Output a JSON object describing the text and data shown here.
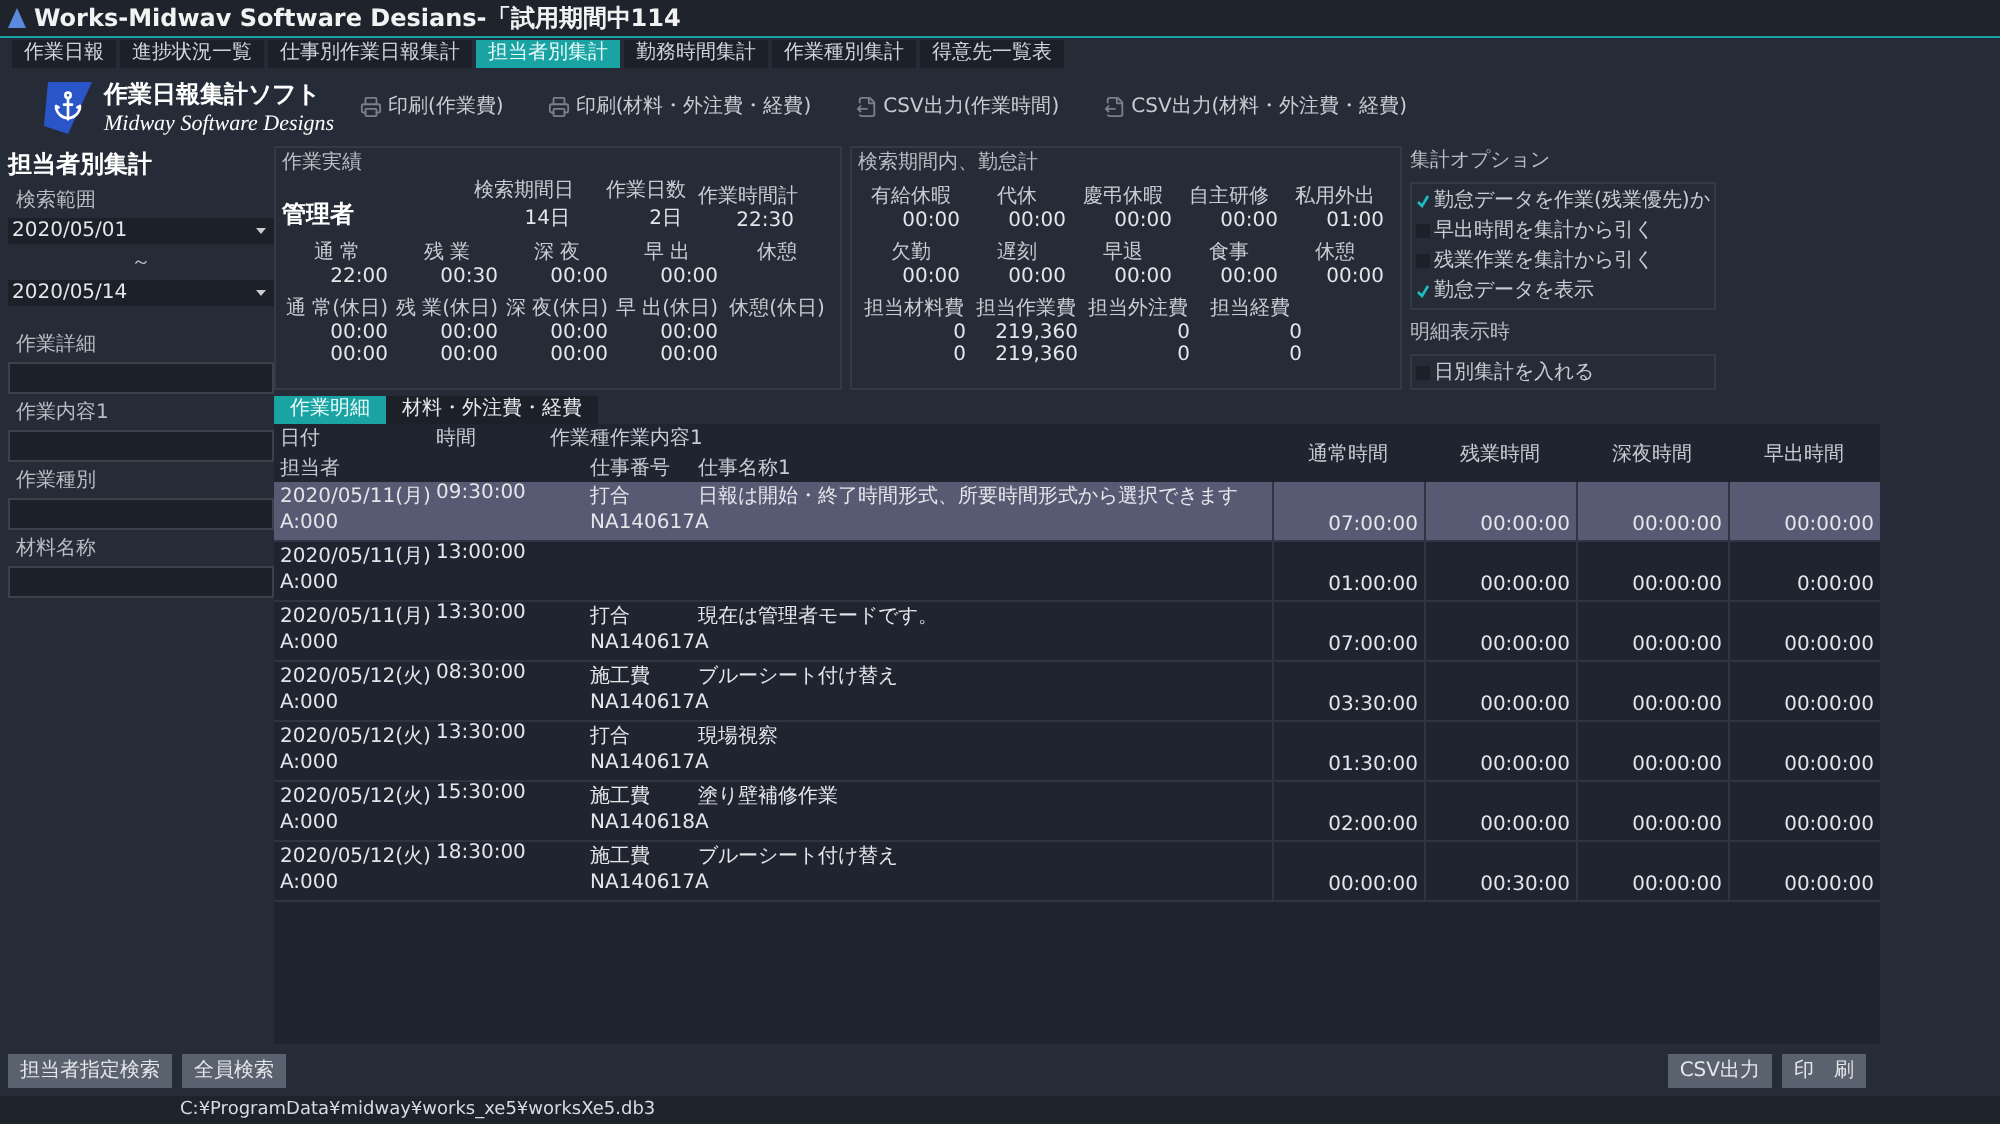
{
  "window": {
    "title": "Works-Midwav Software Desians-「試用期間中114"
  },
  "nav_tabs": [
    {
      "label": "作業日報",
      "selected": false
    },
    {
      "label": "進捗状況一覧",
      "selected": false
    },
    {
      "label": "仕事別作業日報集計",
      "selected": false
    },
    {
      "label": "担当者別集計",
      "selected": true
    },
    {
      "label": "勤務時間集計",
      "selected": false
    },
    {
      "label": "作業種別集計",
      "selected": false
    },
    {
      "label": "得意先一覧表",
      "selected": false
    }
  ],
  "app": {
    "name": "作業日報集計ソフト",
    "subtitle": "Midway Software Designs"
  },
  "toolbar": [
    {
      "label": "印刷(作業費)",
      "kind": "print"
    },
    {
      "label": "印刷(材料・外注費・経費)",
      "kind": "print"
    },
    {
      "label": "CSV出力(作業時間)",
      "kind": "csv"
    },
    {
      "label": "CSV出力(材料・外注費・経費)",
      "kind": "csv"
    }
  ],
  "left": {
    "title": "担当者別集計",
    "range_label": "検索範囲",
    "from": "2020/05/01",
    "separator": "～",
    "to": "2020/05/14",
    "fields": [
      {
        "label": "作業詳細"
      },
      {
        "label": "作業内容1"
      },
      {
        "label": "作業種別"
      },
      {
        "label": "材料名称"
      }
    ]
  },
  "results": {
    "title": "作業実績",
    "name": "管理者",
    "period_stats": [
      {
        "label": "検索期間日",
        "value": "14日"
      },
      {
        "label": "作業日数",
        "value": "2日"
      },
      {
        "label": "作業時間計",
        "value": "22:30"
      }
    ],
    "cells": [
      {
        "label": "通 常",
        "values": [
          "22:00"
        ]
      },
      {
        "label": "残 業",
        "values": [
          "00:30"
        ]
      },
      {
        "label": "深 夜",
        "values": [
          "00:00"
        ]
      },
      {
        "label": "早 出",
        "values": [
          "00:00"
        ]
      },
      {
        "label": "休憩"
      },
      {
        "label": "通 常(休日)",
        "values": [
          "00:00",
          "00:00"
        ]
      },
      {
        "label": "残 業(休日)",
        "values": [
          "00:00",
          "00:00"
        ]
      },
      {
        "label": "深 夜(休日)",
        "values": [
          "00:00",
          "00:00"
        ]
      },
      {
        "label": "早 出(休日)",
        "values": [
          "00:00",
          "00:00"
        ]
      },
      {
        "label": "休憩(休日)"
      }
    ]
  },
  "attendance": {
    "title": "検索期間内、勤怠計",
    "cells": [
      {
        "label": "有給休暇",
        "values": [
          "00:00"
        ]
      },
      {
        "label": "代休",
        "values": [
          "00:00"
        ]
      },
      {
        "label": "慶弔休暇",
        "values": [
          "00:00"
        ]
      },
      {
        "label": "自主研修",
        "values": [
          "00:00"
        ]
      },
      {
        "label": "私用外出",
        "values": [
          "01:00"
        ]
      },
      {
        "label": "欠勤",
        "values": [
          "00:00"
        ]
      },
      {
        "label": "遅刻",
        "values": [
          "00:00"
        ]
      },
      {
        "label": "早退",
        "values": [
          "00:00"
        ]
      },
      {
        "label": "食事",
        "values": [
          "00:00"
        ]
      },
      {
        "label": "休憩",
        "values": [
          "00:00"
        ]
      }
    ],
    "cost_cells": [
      {
        "label": "担当材料費",
        "values": [
          "0",
          "0"
        ]
      },
      {
        "label": "担当作業費",
        "values": [
          "219,360",
          "219,360"
        ]
      },
      {
        "label": "担当外注費",
        "values": [
          "0",
          "0"
        ]
      },
      {
        "label": "担当経費",
        "values": [
          "0",
          "0"
        ]
      }
    ]
  },
  "options": {
    "title": "集計オプション",
    "items": [
      {
        "label": "勤怠データを作業(残業優先)か",
        "checked": true
      },
      {
        "label": "早出時間を集計から引く",
        "checked": false
      },
      {
        "label": "残業作業を集計から引く",
        "checked": false
      },
      {
        "label": "勤怠データを表示",
        "checked": true
      }
    ]
  },
  "detail_options": {
    "title": "明細表示時",
    "items": [
      {
        "label": "日別集計を入れる",
        "checked": false
      }
    ]
  },
  "detail_tabs": [
    {
      "label": "作業明細",
      "selected": true
    },
    {
      "label": "材料・外注費・経費",
      "selected": false
    }
  ],
  "table": {
    "header_top": [
      "日付",
      "時間",
      "作業種作業内容1"
    ],
    "header_bottom": [
      "担当者",
      "仕事番号",
      "仕事名称1"
    ],
    "time_columns": [
      "通常時間",
      "残業時間",
      "深夜時間",
      "早出時間"
    ],
    "rows": [
      {
        "date": "2020/05/11(月)",
        "time": "09:30:00",
        "type": "打合",
        "content": "日報は開始・終了時間形式、所要時間形式から選択できます",
        "staff": "A:000",
        "job_no": "NA140617A",
        "values": [
          "07:00:00",
          "00:00:00",
          "00:00:00",
          "00:00:00"
        ],
        "selected": true
      },
      {
        "date": "2020/05/11(月)",
        "time": "13:00:00",
        "staff": "A:000",
        "values": [
          "01:00:00",
          "00:00:00",
          "00:00:00",
          "0:00:00"
        ],
        "selected": false
      },
      {
        "date": "2020/05/11(月)",
        "time": "13:30:00",
        "type": "打合",
        "content": "現在は管理者モードです。",
        "staff": "A:000",
        "job_no": "NA140617A",
        "values": [
          "07:00:00",
          "00:00:00",
          "00:00:00",
          "00:00:00"
        ],
        "selected": false
      },
      {
        "date": "2020/05/12(火)",
        "time": "08:30:00",
        "type": "施工費",
        "content": "ブルーシート付け替え",
        "staff": "A:000",
        "job_no": "NA140617A",
        "values": [
          "03:30:00",
          "00:00:00",
          "00:00:00",
          "00:00:00"
        ],
        "selected": false
      },
      {
        "date": "2020/05/12(火)",
        "time": "13:30:00",
        "type": "打合",
        "content": "現場視察",
        "staff": "A:000",
        "job_no": "NA140617A",
        "values": [
          "01:30:00",
          "00:00:00",
          "00:00:00",
          "00:00:00"
        ],
        "selected": false
      },
      {
        "date": "2020/05/12(火)",
        "time": "15:30:00",
        "type": "施工費",
        "content": "塗り壁補修作業",
        "staff": "A:000",
        "job_no": "NA140618A",
        "values": [
          "02:00:00",
          "00:00:00",
          "00:00:00",
          "00:00:00"
        ],
        "selected": false
      },
      {
        "date": "2020/05/12(火)",
        "time": "18:30:00",
        "type": "施工費",
        "content": "ブルーシート付け替え",
        "staff": "A:000",
        "job_no": "NA140617A",
        "values": [
          "00:00:00",
          "00:30:00",
          "00:00:00",
          "00:00:00"
        ],
        "selected": false
      }
    ]
  },
  "bottom_buttons": [
    "担当者指定検索",
    "全員検索"
  ],
  "right_buttons": [
    "CSV出力",
    "印　刷"
  ],
  "status": {
    "path": "C:¥ProgramData¥midway¥works_xe5¥worksXe5.db3"
  }
}
